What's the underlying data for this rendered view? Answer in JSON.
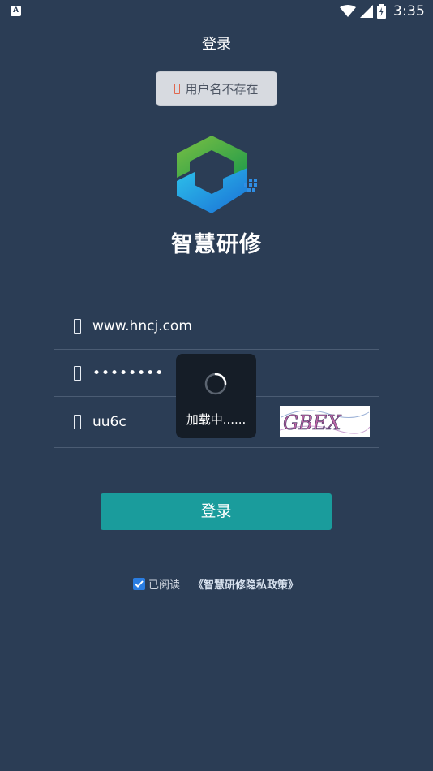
{
  "status_bar": {
    "left_icon": "A",
    "time": "3:35",
    "icons": [
      "wifi-icon",
      "signal-icon",
      "battery-charging-icon"
    ]
  },
  "header": {
    "title": "登录"
  },
  "error_toast": {
    "message": "用户名不存在",
    "icon": "error-icon"
  },
  "branding": {
    "app_name": "智慧研修",
    "logo": "app-logo"
  },
  "form": {
    "username": {
      "value": "www.hncj.com",
      "icon": "user-icon"
    },
    "password": {
      "value": "••••••••",
      "icon": "lock-icon"
    },
    "captcha": {
      "value": "uu6c",
      "icon": "shield-icon",
      "image_text": "GBEX"
    }
  },
  "login_button": {
    "label": "登录"
  },
  "agreement": {
    "checked": true,
    "text": "已阅读",
    "policy_link": "《智慧研修隐私政策》"
  },
  "loading": {
    "text": "加载中......"
  },
  "colors": {
    "background": "#2b3d55",
    "button": "#1a9c9c",
    "checkbox": "#2a7de1",
    "loading_bg": "#151d27"
  }
}
